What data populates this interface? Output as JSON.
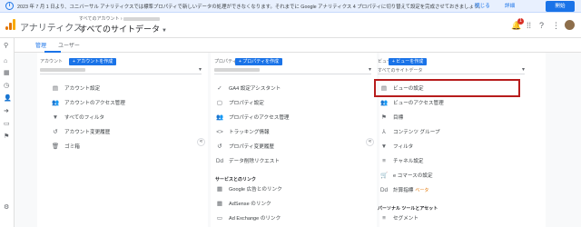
{
  "banner": {
    "text": "2023 年 7 月 1 日より、ユニバーサル アナリティクスでは標準プロパティで新しいデータの処理ができなくなります。それまでに Google アナリティクス 4 プロパティに切り替えて設定を完成させておきましょう。",
    "close_label": "閉じる",
    "detail_label": "詳細",
    "start_label": "開始"
  },
  "header": {
    "app_title": "アナリティクス",
    "account_prefix": "すべてのアカウント ›",
    "view_title": "すべてのサイトデータ",
    "notification_count": "1"
  },
  "tabs": [
    "管理",
    "ユーザー"
  ],
  "account": {
    "heading": "アカウント",
    "create_label": "+ アカウントを作成",
    "items": [
      {
        "icon": "▤",
        "label": "アカウント設定"
      },
      {
        "icon": "👥",
        "label": "アカウントのアクセス管理"
      },
      {
        "icon": "▼",
        "label": "すべてのフィルタ"
      },
      {
        "icon": "↺",
        "label": "アカウント変更履歴"
      },
      {
        "icon": "🗑",
        "label": "ゴミ箱"
      }
    ]
  },
  "property": {
    "heading": "プロパティ",
    "create_label": "+ プロパティを作成",
    "items": [
      {
        "icon": "✓",
        "label": "GA4 設定アシスタント"
      },
      {
        "icon": "▢",
        "label": "プロパティ設定"
      },
      {
        "icon": "👥",
        "label": "プロパティのアクセス管理"
      },
      {
        "icon": "<>",
        "label": "トラッキング情報"
      },
      {
        "icon": "↺",
        "label": "プロパティ変更履歴"
      },
      {
        "icon": "Dd",
        "label": "データ削除リクエスト"
      }
    ],
    "section_label": "サービスとのリンク",
    "link_items": [
      {
        "icon": "▦",
        "label": "Google 広告とのリンク"
      },
      {
        "icon": "▦",
        "label": "AdSense のリンク"
      },
      {
        "icon": "▭",
        "label": "Ad Exchange のリンク"
      }
    ]
  },
  "view": {
    "heading": "ビュー",
    "create_label": "+ ビューを作成",
    "dropdown_value": "すべてのサイトデータ",
    "items": [
      {
        "icon": "▤",
        "label": "ビューの設定"
      },
      {
        "icon": "👥",
        "label": "ビューのアクセス管理"
      },
      {
        "icon": "⚑",
        "label": "目標"
      },
      {
        "icon": "⅄",
        "label": "コンテンツ グループ"
      },
      {
        "icon": "▼",
        "label": "フィルタ"
      },
      {
        "icon": "≡",
        "label": "チャネル設定"
      },
      {
        "icon": "🛒",
        "label": "e コマースの設定"
      },
      {
        "icon": "Dd",
        "label": "計算指標",
        "badge": "ベータ"
      }
    ],
    "section_label": "パーソナル ツールとアセット",
    "section_items": [
      {
        "icon": "≡",
        "label": "セグメント"
      }
    ]
  },
  "colors": {
    "accent": "#1a73e8",
    "highlight": "#b71c1c",
    "banner_bg": "#e8f0fe"
  }
}
